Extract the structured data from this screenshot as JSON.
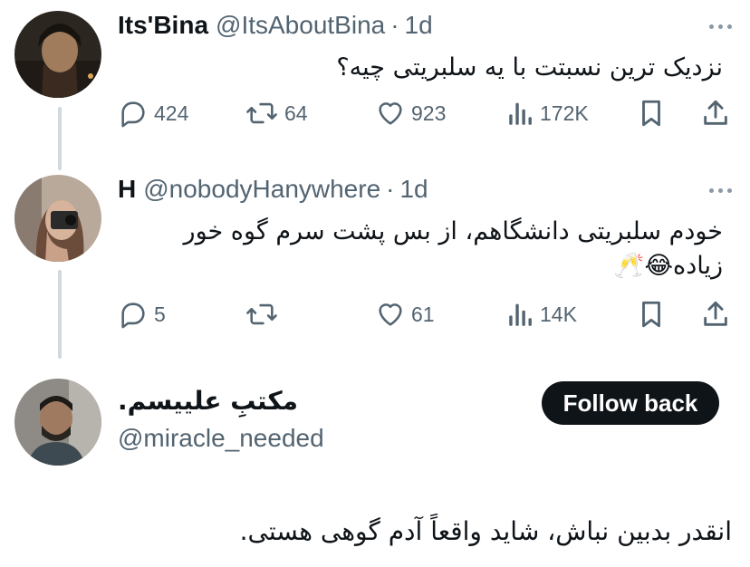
{
  "tweets": [
    {
      "name": "Its'Bina",
      "handle": "@ItsAboutBina",
      "dot": "·",
      "time": "1d",
      "text_lines": [
        "نزدیک ترین نسبتت با یه سلبریتی چیه؟"
      ],
      "replies": "424",
      "retweets": "64",
      "likes": "923",
      "views": "172K"
    },
    {
      "name": "H",
      "handle": "@nobodyHanywhere",
      "dot": "·",
      "time": "1d",
      "text_lines": [
        "خودم سلبریتی دانشگاهم، از بس پشت سرم گوه خور",
        "زیاده😂🥂"
      ],
      "replies": "5",
      "retweets": "",
      "likes": "61",
      "views": "14K"
    }
  ],
  "profile": {
    "name": "مکتبِ علییسم.",
    "handle": "@miracle_needed",
    "follow_label": "Follow back",
    "bio": "انقدر بدبین نباش، شاید واقعاً آدم گوهی هستی."
  },
  "colors": {
    "text": "#0f1419",
    "secondary": "#536471",
    "thread_line": "#cfd9de",
    "button_bg": "#0f1419"
  },
  "icons": [
    "reply-icon",
    "retweet-icon",
    "like-icon",
    "views-icon",
    "bookmark-icon",
    "share-icon",
    "more-icon"
  ]
}
